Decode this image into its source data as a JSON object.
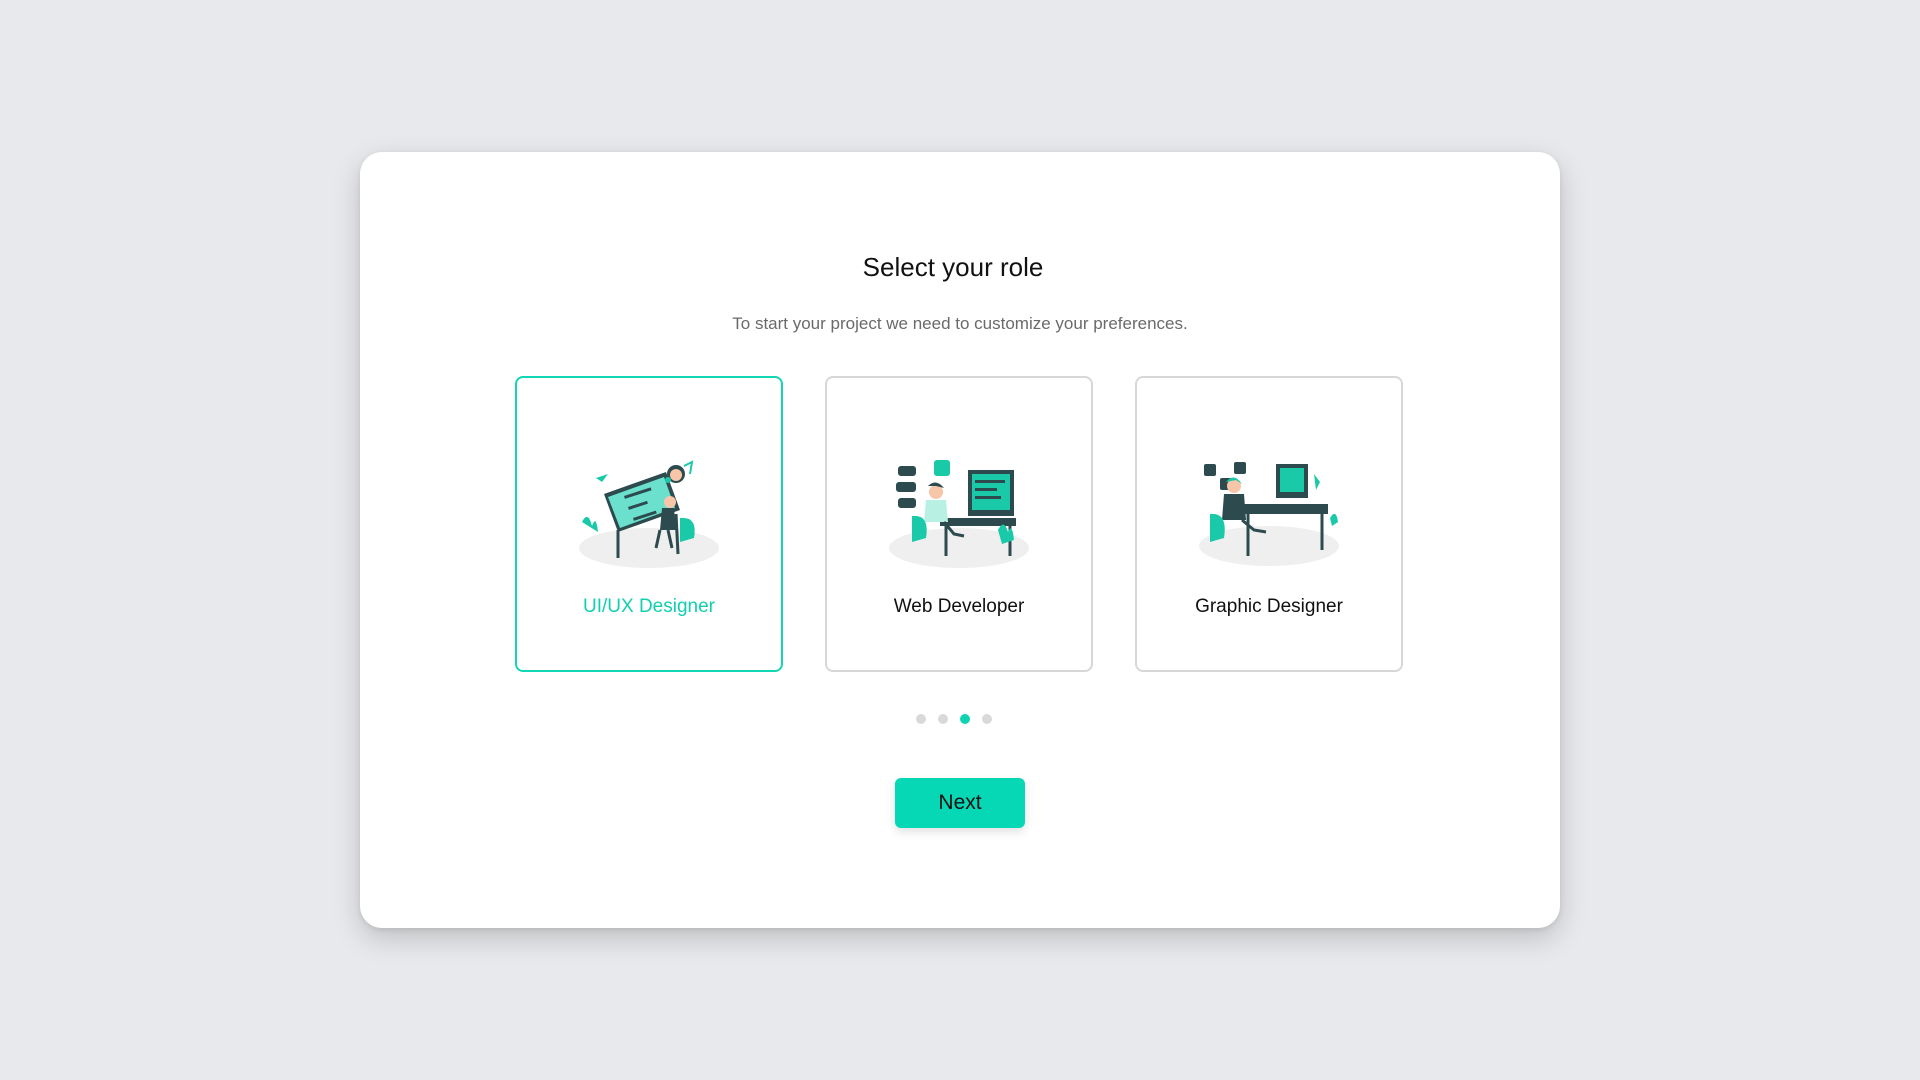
{
  "modal": {
    "title": "Select your role",
    "subtitle": "To start your project we need to customize your preferences."
  },
  "roles": [
    {
      "label": "UI/UX Designer",
      "selected": true,
      "icon": "ui-ux-designer-illustration"
    },
    {
      "label": "Web Developer",
      "selected": false,
      "icon": "web-developer-illustration"
    },
    {
      "label": "Graphic Designer",
      "selected": false,
      "icon": "graphic-designer-illustration"
    }
  ],
  "pagination": {
    "total": 4,
    "active_index": 3
  },
  "next_label": "Next",
  "colors": {
    "accent": "#06d8b6",
    "background": "#e8e9ec",
    "card_border": "#d7d7d7"
  }
}
